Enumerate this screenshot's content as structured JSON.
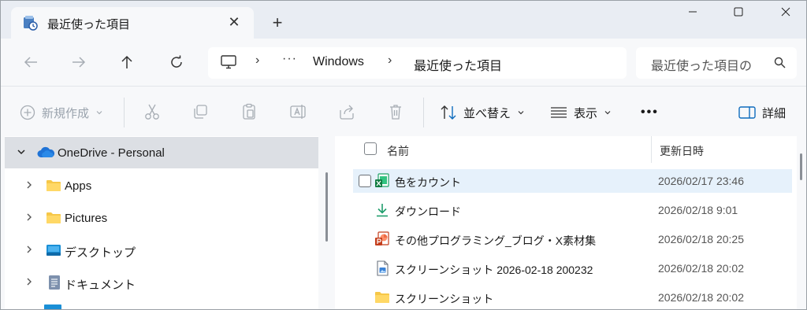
{
  "tab": {
    "title": "最近使った項目",
    "close": "✕",
    "new_tab": "+"
  },
  "window_controls": {
    "minimize": "—",
    "maximize": "☐",
    "close": "✕"
  },
  "address": {
    "more": "···",
    "crumbs": [
      "Windows",
      "最近使った項目"
    ],
    "separator": "›"
  },
  "search": {
    "placeholder": "最近使った項目の"
  },
  "commands": {
    "new": "新規作成",
    "sort": "並べ替え",
    "view": "表示",
    "more": "•••",
    "details": "詳細"
  },
  "sidebar": {
    "items": [
      {
        "label": "OneDrive - Personal",
        "icon": "cloud-icon"
      },
      {
        "label": "Apps",
        "icon": "folder-icon"
      },
      {
        "label": "Pictures",
        "icon": "folder-icon"
      },
      {
        "label": "デスクトップ",
        "icon": "desktop-folder-icon"
      },
      {
        "label": "ドキュメント",
        "icon": "documents-folder-icon"
      }
    ]
  },
  "columns": {
    "name": "名前",
    "date": "更新日時"
  },
  "files": [
    {
      "name": "色をカウント",
      "date": "2026/02/17 23:46",
      "icon": "excel-file-icon"
    },
    {
      "name": "ダウンロード",
      "date": "2026/02/18 9:01",
      "icon": "download-icon"
    },
    {
      "name": "その他プログラミング_ブログ・X素材集",
      "date": "2026/02/18 20:25",
      "icon": "powerpoint-file-icon"
    },
    {
      "name": "スクリーンショット 2026-02-18 200232",
      "date": "2026/02/18 20:02",
      "icon": "image-file-icon"
    },
    {
      "name": "スクリーンショット",
      "date": "2026/02/18 20:02",
      "icon": "folder-icon"
    }
  ],
  "colors": {
    "accent": "#0f6cbd",
    "folder": "#f6c748",
    "hover_row": "#e6f1fb",
    "selected_nav": "#dcdfe4"
  }
}
